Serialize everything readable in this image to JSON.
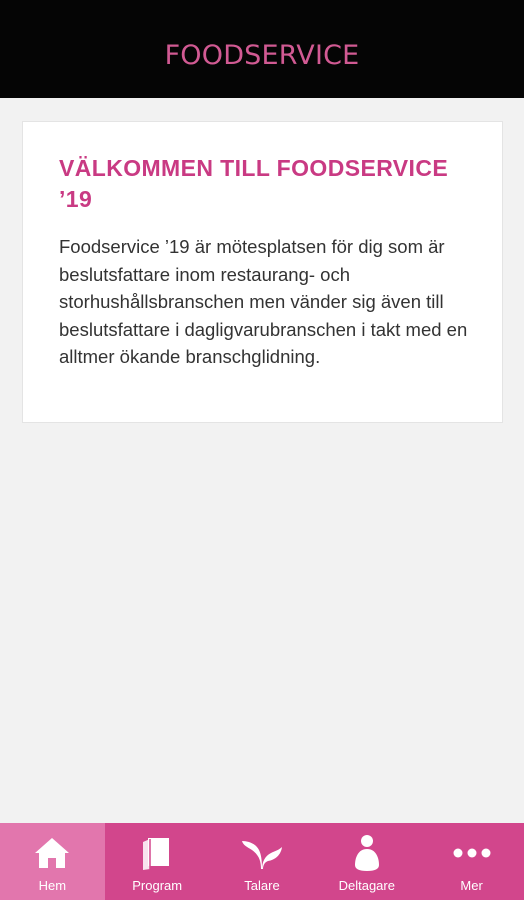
{
  "header": {
    "title": "FOODSERVICE"
  },
  "welcome": {
    "title": "VÄLKOMMEN TILL FOODSERVICE ’19",
    "body": "Foodservice ’19 är mötesplatsen för dig som är beslutsfattare inom restaurang- och storhushållsbranschen men vänder sig även till beslutsfattare i dagligvarubranschen i takt med en alltmer ökande branschglidning."
  },
  "tabbar": {
    "tabs": [
      {
        "label": "Hem",
        "icon": "home-icon",
        "active": true
      },
      {
        "label": "Program",
        "icon": "book-icon",
        "active": false
      },
      {
        "label": "Talare",
        "icon": "sprout-icon",
        "active": false
      },
      {
        "label": "Deltagare",
        "icon": "person-icon",
        "active": false
      },
      {
        "label": "Mer",
        "icon": "more-icon",
        "active": false
      }
    ]
  },
  "colors": {
    "accent": "#d2468c",
    "active_tab": "#e276ad",
    "header_bg": "#050505",
    "title_text": "#c93a83"
  }
}
